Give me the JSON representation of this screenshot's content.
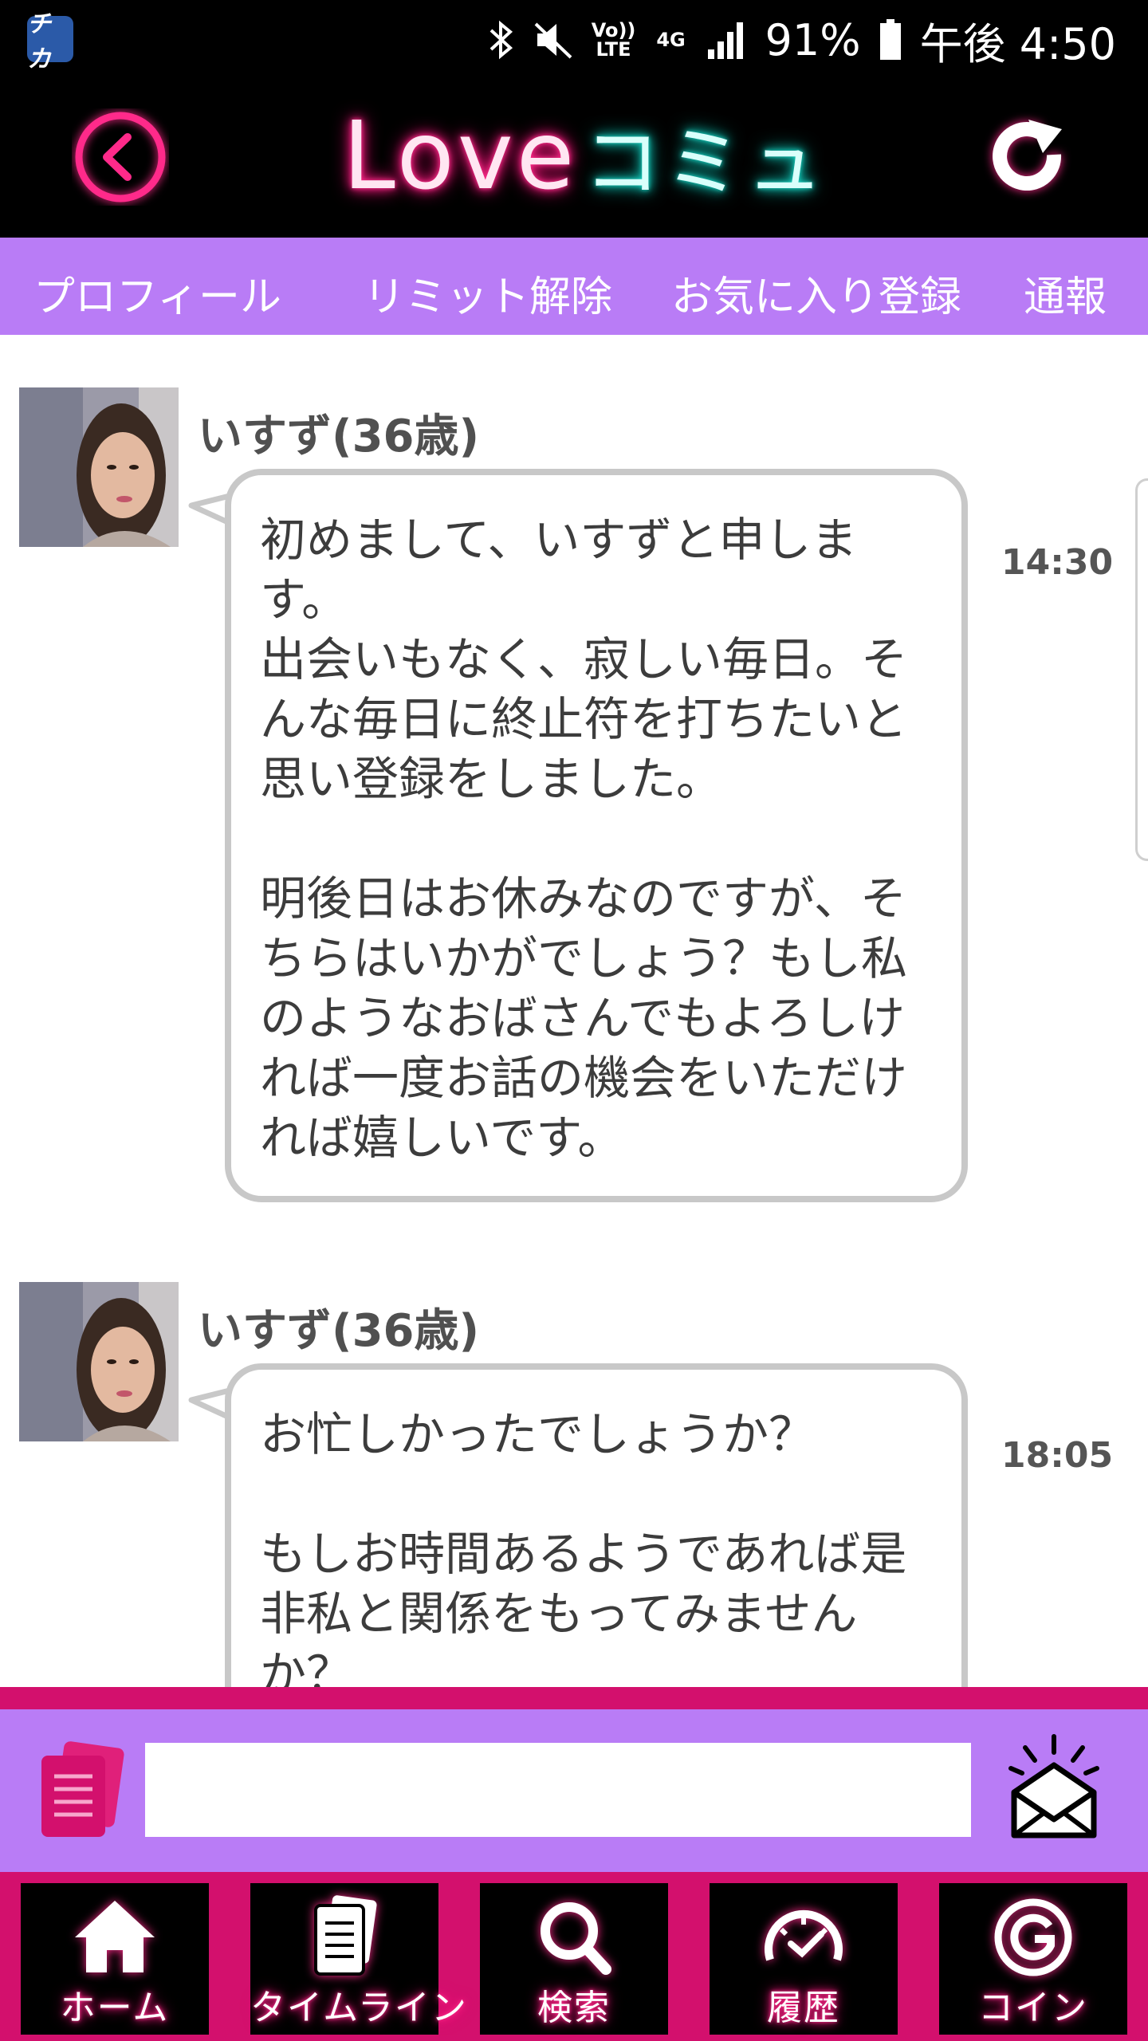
{
  "status_bar": {
    "app_icon": "チカ",
    "network_volte": "Vo)) LTE",
    "network_type": "4G",
    "battery": "91%",
    "time": "午後 4:50",
    "icons": [
      "bluetooth-icon",
      "mute-icon",
      "signal-icon",
      "battery-icon"
    ]
  },
  "header": {
    "logo_love": "Love",
    "logo_comu": "コミュ",
    "back_icon": "back-arrow-icon",
    "refresh_icon": "refresh-icon"
  },
  "menu": [
    "プロフィール",
    "リミット解除",
    "お気に入り登録",
    "通報"
  ],
  "messages": [
    {
      "sender": "いすず(36歳)",
      "text": "初めまして、いすずと申します。\n出会いもなく、寂しい毎日。そんな毎日に終止符を打ちたいと思い登録をしました。\n\n明後日はお休みなのですが、そちらはいかがでしょう？もし私のようなおばさんでもよろしければ一度お話の機会をいただければ嬉しいです。",
      "time": "14:30"
    },
    {
      "sender": "いすず(36歳)",
      "text": "お忙しかったでしょうか？\n\nもしお時間あるようであれば是非私と関係をもってみませんか？",
      "time": "18:05"
    }
  ],
  "input": {
    "value": "",
    "placeholder": ""
  },
  "colors": {
    "accent_purple": "#b97cf6",
    "accent_pink": "#d3106d",
    "neon_pink": "#ff2a8a",
    "neon_teal": "#19d8c8"
  },
  "bottom_nav": [
    {
      "label": "ホーム",
      "icon": "home-icon"
    },
    {
      "label": "タイムライン",
      "icon": "timeline-icon"
    },
    {
      "label": "検索",
      "icon": "search-icon"
    },
    {
      "label": "履歴",
      "icon": "history-icon"
    },
    {
      "label": "コイン",
      "icon": "coin-icon"
    }
  ]
}
